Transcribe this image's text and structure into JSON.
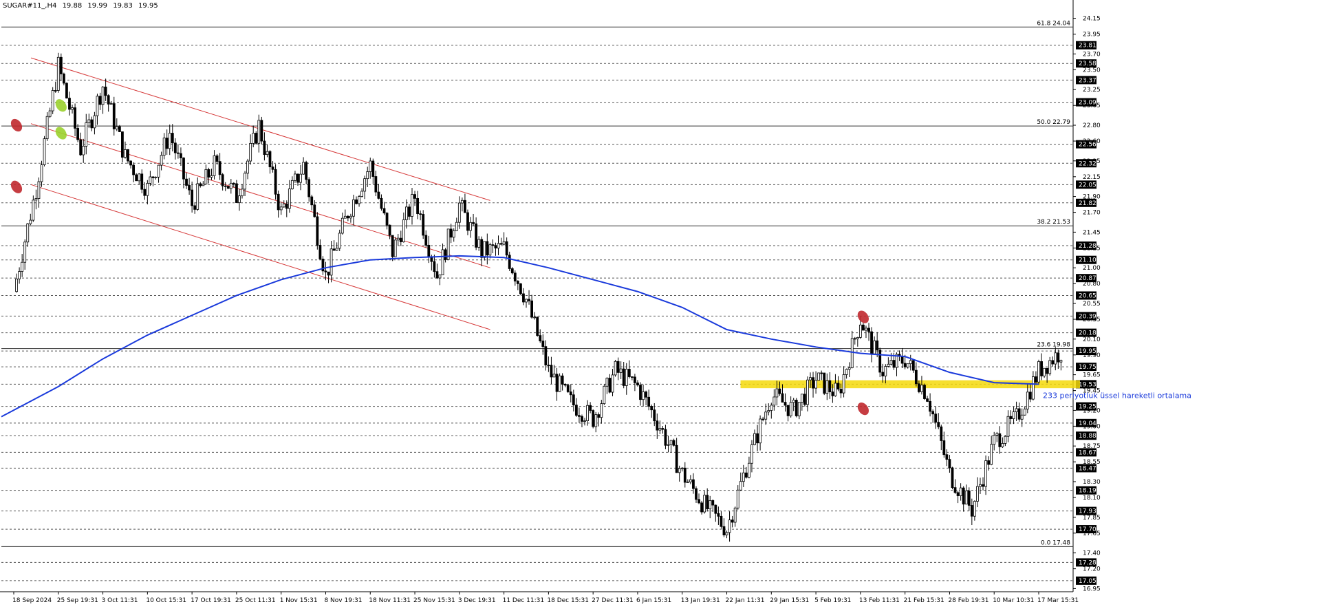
{
  "header": {
    "symbol": "SUGAR#11_,H4",
    "open": "19.88",
    "high": "19.99",
    "low": "19.83",
    "close": "19.95"
  },
  "chart_data": {
    "type": "candlestick",
    "title": "",
    "ylim": [
      16.91,
      24.19
    ],
    "y_ticks": [
      "24.15",
      "23.95",
      "23.70",
      "23.50",
      "23.25",
      "23.05",
      "22.80",
      "22.60",
      "22.35",
      "22.15",
      "21.90",
      "21.70",
      "21.45",
      "21.25",
      "21.00",
      "20.80",
      "20.55",
      "20.35",
      "20.10",
      "19.90",
      "19.65",
      "19.45",
      "19.20",
      "19.00",
      "18.75",
      "18.55",
      "18.30",
      "18.10",
      "17.85",
      "17.65",
      "17.40",
      "17.20",
      "16.95"
    ],
    "x_labels": [
      "18 Sep 2024",
      "25 Sep 19:31",
      "3 Oct 11:31",
      "10 Oct 15:31",
      "17 Oct 19:31",
      "25 Oct 11:31",
      "1 Nov 15:31",
      "8 Nov 19:31",
      "18 Nov 11:31",
      "25 Nov 15:31",
      "3 Dec 19:31",
      "11 Dec 11:31",
      "18 Dec 15:31",
      "27 Dec 11:31",
      "6 Jan 15:31",
      "13 Jan 19:31",
      "22 Jan 11:31",
      "29 Jan 15:31",
      "5 Feb 19:31",
      "13 Feb 11:31",
      "21 Feb 15:31",
      "28 Feb 19:31",
      "10 Mar 10:31",
      "17 Mar 15:31"
    ],
    "dashed_levels": [
      {
        "price": 23.81,
        "label": "23.81"
      },
      {
        "price": 23.58,
        "label": "23.58"
      },
      {
        "price": 23.37,
        "label": "23.37"
      },
      {
        "price": 23.09,
        "label": "23.09"
      },
      {
        "price": 22.56,
        "label": "22.56"
      },
      {
        "price": 22.32,
        "label": "22.32"
      },
      {
        "price": 22.05,
        "label": "22.05"
      },
      {
        "price": 21.82,
        "label": "21.82"
      },
      {
        "price": 21.28,
        "label": "21.28"
      },
      {
        "price": 21.1,
        "label": "21.10"
      },
      {
        "price": 20.87,
        "label": "20.87"
      },
      {
        "price": 20.65,
        "label": "20.65"
      },
      {
        "price": 20.39,
        "label": "20.39"
      },
      {
        "price": 20.18,
        "label": "20.18"
      },
      {
        "price": 19.95,
        "label": "19.95"
      },
      {
        "price": 19.75,
        "label": "19.75"
      },
      {
        "price": 19.53,
        "label": "19.53"
      },
      {
        "price": 19.25,
        "label": "19.25"
      },
      {
        "price": 19.04,
        "label": "19.04"
      },
      {
        "price": 18.88,
        "label": "18.88"
      },
      {
        "price": 18.67,
        "label": "18.67"
      },
      {
        "price": 18.47,
        "label": "18.47"
      },
      {
        "price": 18.19,
        "label": "18.19"
      },
      {
        "price": 17.93,
        "label": "17.93"
      },
      {
        "price": 17.7,
        "label": "17.70"
      },
      {
        "price": 17.28,
        "label": "17.28"
      },
      {
        "price": 17.05,
        "label": "17.05"
      }
    ],
    "fibo_levels": [
      {
        "price": 24.04,
        "label": "61.8 24.04"
      },
      {
        "price": 22.79,
        "label": "50.0 22.79"
      },
      {
        "price": 21.53,
        "label": "38.2 21.53"
      },
      {
        "price": 19.98,
        "label": "23.6 19.98"
      },
      {
        "price": 17.48,
        "label": "0.0 17.48"
      }
    ],
    "channel": {
      "color": "#d63a3a",
      "lines": [
        [
          [
            "18 Sep 2024",
            23.65
          ],
          [
            "11 Dec 11:31",
            21.85
          ]
        ],
        [
          [
            "18 Sep 2024",
            22.82
          ],
          [
            "11 Dec 11:31",
            21.0
          ]
        ],
        [
          [
            "18 Sep 2024",
            22.05
          ],
          [
            "11 Dec 11:31",
            20.22
          ]
        ]
      ]
    },
    "support_zone": {
      "from": "22 Jan 11:31",
      "to": "17 Mar 15:31",
      "low": 19.48,
      "high": 19.58,
      "color": "#f5d90a"
    },
    "ema": {
      "label": "233 periyotluk üssel hareketli ortalama",
      "color": "#1a3adb",
      "points": [
        [
          "18 Sep 2024",
          19.12
        ],
        [
          "25 Sep 19:31",
          19.5
        ],
        [
          "3 Oct 11:31",
          19.85
        ],
        [
          "10 Oct 15:31",
          20.15
        ],
        [
          "17 Oct 19:31",
          20.4
        ],
        [
          "25 Oct 11:31",
          20.65
        ],
        [
          "1 Nov 15:31",
          20.85
        ],
        [
          "8 Nov 19:31",
          21.0
        ],
        [
          "18 Nov 11:31",
          21.1
        ],
        [
          "25 Nov 15:31",
          21.13
        ],
        [
          "3 Dec 19:31",
          21.15
        ],
        [
          "11 Dec 11:31",
          21.13
        ],
        [
          "18 Dec 15:31",
          21.0
        ],
        [
          "27 Dec 11:31",
          20.85
        ],
        [
          "6 Jan 15:31",
          20.7
        ],
        [
          "13 Jan 19:31",
          20.5
        ],
        [
          "22 Jan 11:31",
          20.22
        ],
        [
          "29 Jan 15:31",
          20.1
        ],
        [
          "5 Feb 19:31",
          20.0
        ],
        [
          "13 Feb 11:31",
          19.92
        ],
        [
          "21 Feb 15:31",
          19.88
        ],
        [
          "28 Feb 19:31",
          19.68
        ],
        [
          "10 Mar 10:31",
          19.55
        ],
        [
          "17 Mar 15:31",
          19.53
        ]
      ]
    },
    "markers": [
      {
        "at": "18 Sep 2024",
        "price": 22.8,
        "color": "#c0282d"
      },
      {
        "at": "18 Sep 2024",
        "price": 22.02,
        "color": "#c0282d"
      },
      {
        "at": "25 Sep 19:31",
        "price": 23.05,
        "color": "#9bd12e"
      },
      {
        "at": "25 Sep 19:31",
        "price": 22.7,
        "color": "#9bd12e"
      },
      {
        "at": "13 Feb 11:31",
        "price": 20.38,
        "color": "#c0282d"
      },
      {
        "at": "13 Feb 11:31",
        "price": 19.22,
        "color": "#c0282d"
      }
    ],
    "path": [
      [
        "18 Sep 2024",
        20.7
      ],
      [
        "18 Sep 2024",
        22.0
      ],
      [
        "25 Sep 19:31",
        23.55
      ],
      [
        "25 Sep 19:31",
        22.5
      ],
      [
        "3 Oct 11:31",
        23.3
      ],
      [
        "3 Oct 11:31",
        22.4
      ],
      [
        "10 Oct 15:31",
        22.0
      ],
      [
        "10 Oct 15:31",
        22.7
      ],
      [
        "17 Oct 19:31",
        21.8
      ],
      [
        "17 Oct 19:31",
        22.3
      ],
      [
        "25 Oct 11:31",
        21.9
      ],
      [
        "25 Oct 11:31",
        22.8
      ],
      [
        "1 Nov 15:31",
        21.7
      ],
      [
        "1 Nov 15:31",
        22.3
      ],
      [
        "8 Nov 19:31",
        20.9
      ],
      [
        "8 Nov 19:31",
        21.7
      ],
      [
        "18 Nov 11:31",
        22.3
      ],
      [
        "18 Nov 11:31",
        21.2
      ],
      [
        "25 Nov 15:31",
        21.9
      ],
      [
        "25 Nov 15:31",
        20.9
      ],
      [
        "3 Dec 19:31",
        21.8
      ],
      [
        "3 Dec 19:31",
        21.2
      ],
      [
        "11 Dec 11:31",
        21.25
      ],
      [
        "11 Dec 11:31",
        20.6
      ],
      [
        "18 Dec 15:31",
        19.7
      ],
      [
        "18 Dec 15:31",
        19.3
      ],
      [
        "27 Dec 11:31",
        19.1
      ],
      [
        "27 Dec 11:31",
        19.7
      ],
      [
        "6 Jan 15:31",
        19.5
      ],
      [
        "6 Jan 15:31",
        19.0
      ],
      [
        "13 Jan 19:31",
        18.4
      ],
      [
        "13 Jan 19:31",
        18.0
      ],
      [
        "22 Jan 11:31",
        17.7
      ],
      [
        "22 Jan 11:31",
        18.6
      ],
      [
        "29 Jan 15:31",
        19.4
      ],
      [
        "29 Jan 15:31",
        19.2
      ],
      [
        "5 Feb 19:31",
        19.6
      ],
      [
        "5 Feb 19:31",
        19.4
      ],
      [
        "13 Feb 11:31",
        20.35
      ],
      [
        "13 Feb 11:31",
        19.7
      ],
      [
        "21 Feb 15:31",
        19.85
      ],
      [
        "21 Feb 15:31",
        19.4
      ],
      [
        "28 Feb 19:31",
        18.4
      ],
      [
        "28 Feb 19:31",
        17.95
      ],
      [
        "10 Mar 10:31",
        18.8
      ],
      [
        "10 Mar 10:31",
        19.1
      ],
      [
        "17 Mar 15:31",
        19.7
      ],
      [
        "17 Mar 15:31",
        19.95
      ]
    ],
    "colors": {
      "candle": "#000000",
      "grid_dash": "#555555",
      "fibo": "#333333",
      "axis_tag_bg": "#000000",
      "axis_tag_fg": "#ffffff"
    }
  }
}
